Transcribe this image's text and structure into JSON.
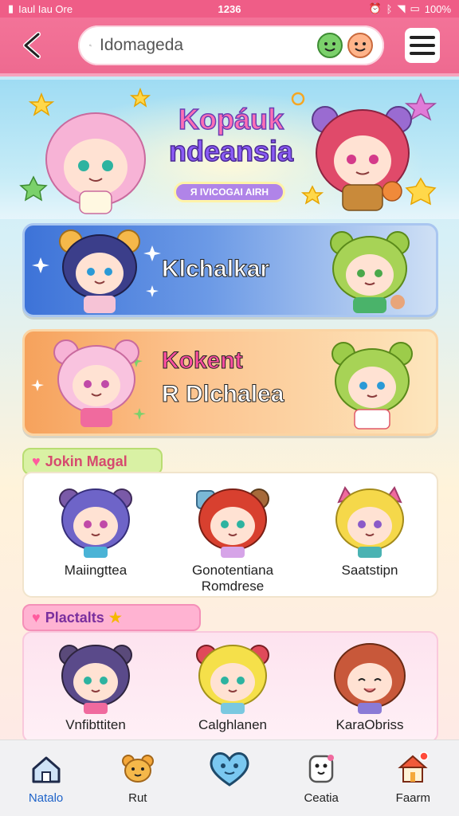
{
  "status_bar": {
    "carrier": "Iaul Iau Ore",
    "time": "1236",
    "battery": "100%"
  },
  "header": {
    "search_placeholder": "Idomagedа"
  },
  "banner": {
    "title_line1": "Kopáuk",
    "title_line2": "ndeansia",
    "badge": "Я IVICOGAI AIRH"
  },
  "cards": [
    {
      "title": "Klchalkar"
    },
    {
      "title_line1": "Kokent",
      "title_line2": "R Dlchalea"
    }
  ],
  "sections": [
    {
      "label": "Jokin Magal",
      "characters": [
        {
          "name": "Maiingttea"
        },
        {
          "name": "Gonotentiana Romdrese"
        },
        {
          "name": "Saatstipn"
        }
      ]
    },
    {
      "label": "Plactalts",
      "characters": [
        {
          "name": "Vnfibttiten"
        },
        {
          "name": "Calghlanen"
        },
        {
          "name": "KaraObriss"
        }
      ]
    }
  ],
  "tabs": [
    {
      "label": "Natalo",
      "icon": "home-icon",
      "active": true
    },
    {
      "label": "Rut",
      "icon": "bear-icon",
      "active": false
    },
    {
      "label": "",
      "icon": "heart-chat-icon",
      "active": false
    },
    {
      "label": "Ceatia",
      "icon": "pet-icon",
      "active": false
    },
    {
      "label": "Faarm",
      "icon": "house-icon",
      "active": false
    }
  ],
  "colors": {
    "accent_pink": "#ef5d87",
    "card_blue": "#3d73d8",
    "card_orange": "#f6a25c",
    "active_tab": "#1e63c9"
  }
}
